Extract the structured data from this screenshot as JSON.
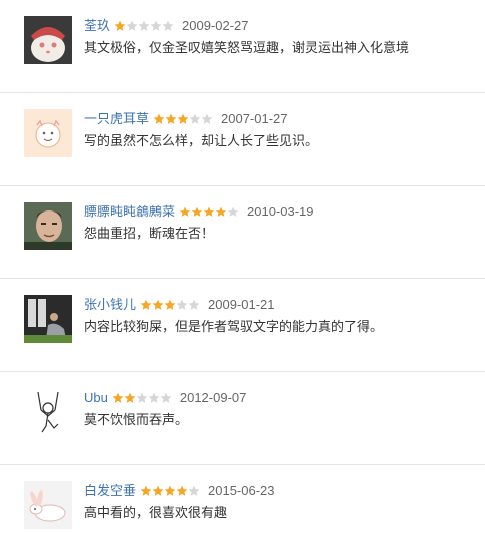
{
  "comments": [
    {
      "user": "荃玖",
      "rating": 1,
      "max_rating": 5,
      "date": "2009-02-27",
      "text": "其文极俗，仅金圣叹嬉笑怒骂逗趣，谢灵运出神入化意境"
    },
    {
      "user": "一只虎耳草",
      "rating": 3,
      "max_rating": 5,
      "date": "2007-01-27",
      "text": "写的虽然不怎么样，却让人长了些见识。"
    },
    {
      "user": "膘膘盹盹鶬鶊菜",
      "rating": 4,
      "max_rating": 5,
      "date": "2010-03-19",
      "text": "怨曲重招，断魂在否！"
    },
    {
      "user": "张小钱儿",
      "rating": 3,
      "max_rating": 5,
      "date": "2009-01-21",
      "text": "内容比较狗屎，但是作者驾驭文字的能力真的了得。"
    },
    {
      "user": "Ubu",
      "rating": 2,
      "max_rating": 5,
      "date": "2012-09-07",
      "text": "莫不饮恨而吞声。"
    },
    {
      "user": "白发空垂",
      "rating": 4,
      "max_rating": 5,
      "date": "2015-06-23",
      "text": "高中看的，很喜欢很有趣"
    }
  ],
  "colors": {
    "star_on": "#f5a623",
    "star_off": "#d6d6d6",
    "username": "#3d73b2"
  }
}
